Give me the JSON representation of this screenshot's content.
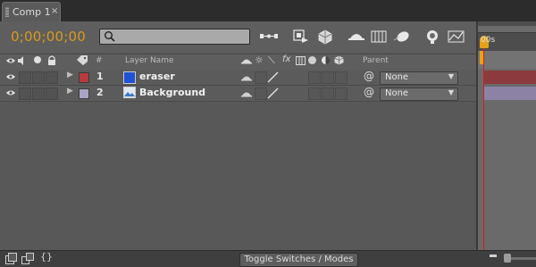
{
  "tab": {
    "label": "Comp 1",
    "close": "×"
  },
  "toolbar": {
    "timecode": "0;00;00;00",
    "search_placeholder": ""
  },
  "header": {
    "col_number": "#",
    "col_layer_name": "Layer Name",
    "col_fx": "fx",
    "col_parent": "Parent"
  },
  "layers": [
    {
      "number": "1",
      "name": "eraser",
      "label_color": "#b83a3e",
      "parent": "None"
    },
    {
      "number": "2",
      "name": "Background",
      "label_color": "#a9a3c6",
      "parent": "None"
    }
  ],
  "timeline": {
    "ruler_label": "00s"
  },
  "bottom": {
    "toggle_label": "Toggle Switches / Modes"
  },
  "colors": {
    "timecode": "#d89b1c",
    "playhead": "#e11a1a",
    "layer1_bar": "#8c3a3d",
    "layer2_bar": "#8b82a6"
  }
}
